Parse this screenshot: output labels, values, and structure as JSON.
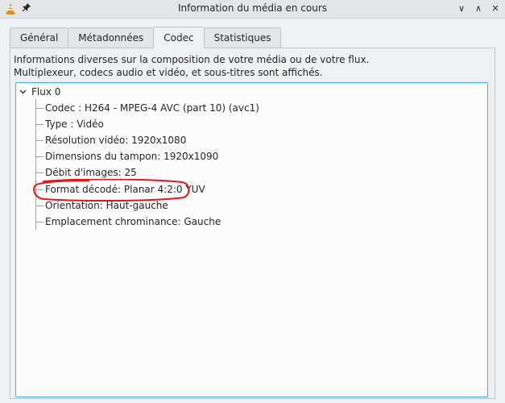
{
  "window": {
    "title": "Information du média en cours",
    "icons": {
      "app": "vlc-cone-icon",
      "pin": "pin-icon",
      "minimize": "chevron-down-icon",
      "maximize": "chevron-up-icon",
      "close": "close-icon"
    },
    "minimize_glyph": "∨",
    "maximize_glyph": "∧",
    "close_glyph": "✕",
    "pin_glyph": "📌"
  },
  "tabs": [
    {
      "label": "Général",
      "active": false
    },
    {
      "label": "Métadonnées",
      "active": false
    },
    {
      "label": "Codec",
      "active": true
    },
    {
      "label": "Statistiques",
      "active": false
    }
  ],
  "codec_panel": {
    "description_line1": "Informations diverses sur la composition de votre média ou de votre flux.",
    "description_line2": "Multiplexeur, codecs audio et vidéo, et sous-titres sont affichés.",
    "tree": {
      "root_label": "Flux 0",
      "expanded": true,
      "children": [
        "Codec : H264 - MPEG-4 AVC (part 10) (avc1)",
        "Type : Vidéo",
        "Résolution vidéo: 1920x1080",
        "Dimensions du tampon: 1920x1090",
        "Débit d'images: 25",
        "Format décodé: Planar 4:2:0 YUV",
        "Orientation: Haut-gauche",
        "Emplacement chrominance: Gauche"
      ]
    }
  },
  "colors": {
    "accent": "#3daee9",
    "annotation": "#e8141c",
    "vlc_orange": "#f08a00"
  }
}
